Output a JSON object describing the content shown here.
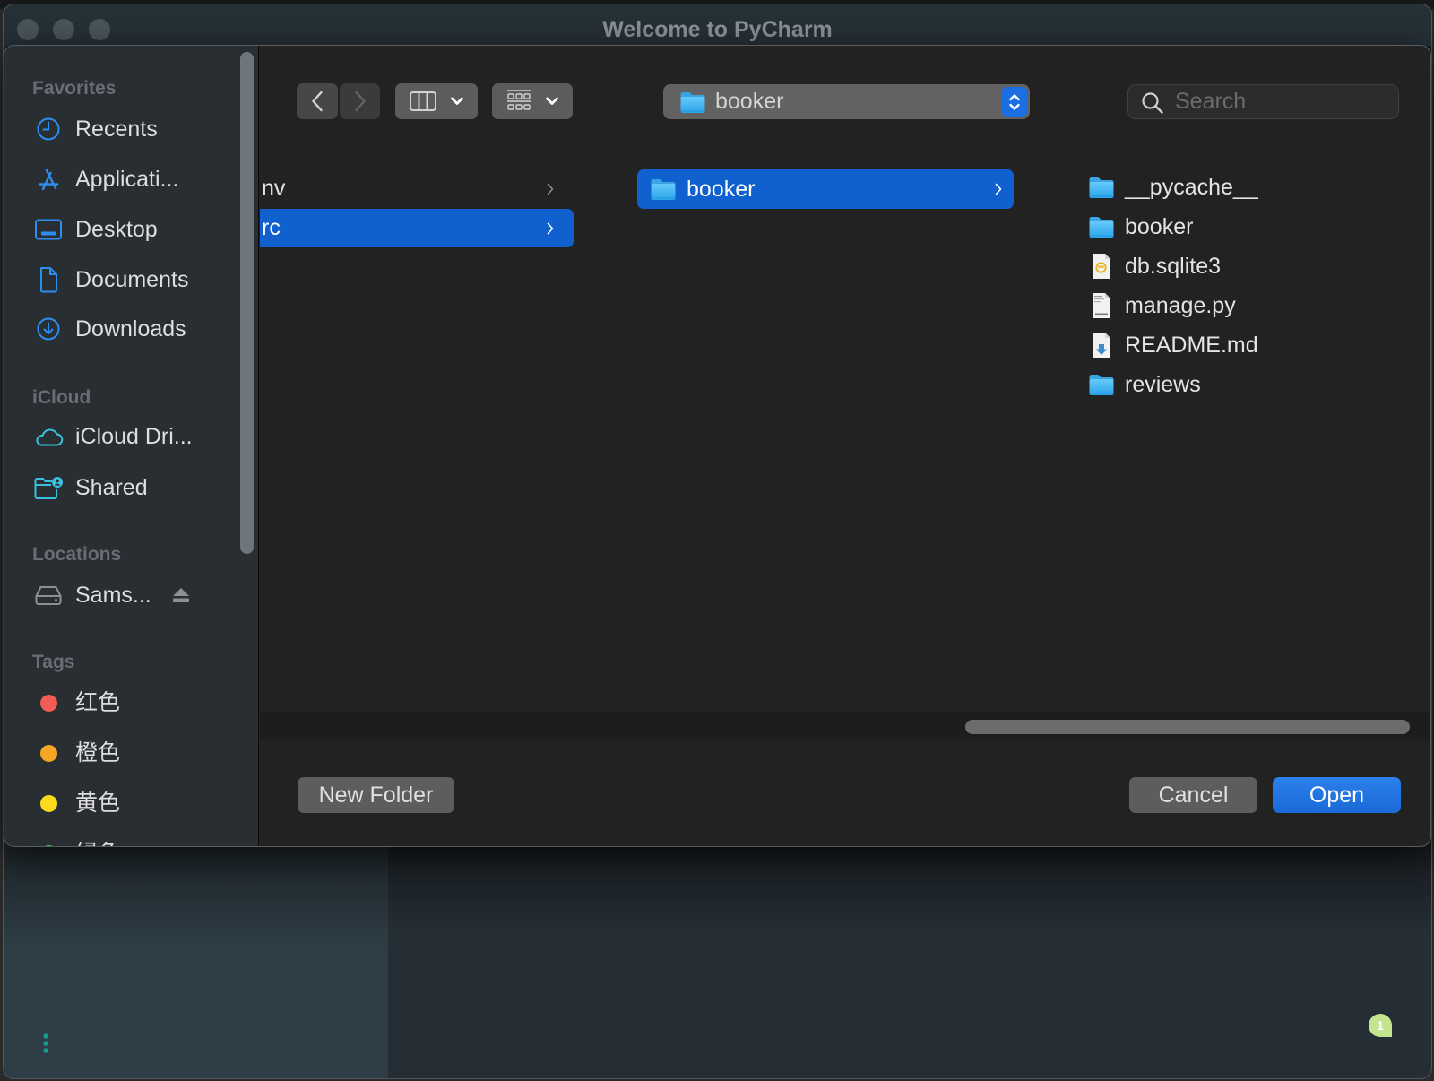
{
  "window": {
    "title": "Welcome to PyCharm",
    "notification_count": "1"
  },
  "dialog": {
    "sidebar": {
      "sections": [
        {
          "label": "Favorites",
          "items": [
            {
              "label": "Recents",
              "icon": "clock-icon"
            },
            {
              "label": "Applicati...",
              "icon": "applications-icon"
            },
            {
              "label": "Desktop",
              "icon": "desktop-icon"
            },
            {
              "label": "Documents",
              "icon": "document-icon"
            },
            {
              "label": "Downloads",
              "icon": "download-icon"
            }
          ]
        },
        {
          "label": "iCloud",
          "items": [
            {
              "label": "iCloud Dri...",
              "icon": "cloud-icon"
            },
            {
              "label": "Shared",
              "icon": "shared-folder-icon"
            }
          ]
        },
        {
          "label": "Locations",
          "items": [
            {
              "label": "Sams...",
              "icon": "hard-drive-icon",
              "action_icon": "eject-icon"
            }
          ]
        },
        {
          "label": "Tags",
          "items": [
            {
              "label": "红色",
              "color": "#f25c54"
            },
            {
              "label": "橙色",
              "color": "#f5a623"
            },
            {
              "label": "黄色",
              "color": "#fbdc1c"
            },
            {
              "label": "绿色",
              "color": "#35c94b"
            }
          ]
        }
      ]
    },
    "toolbar": {
      "back_icon": "chevron-left-icon",
      "forward_icon": "chevron-right-icon",
      "forward_enabled": false,
      "view_mode_icon": "columns-view-icon",
      "group_icon": "gallery-group-icon"
    },
    "path_popup": {
      "value": "booker",
      "icon": "folder-icon"
    },
    "search": {
      "placeholder": "Search",
      "value": ""
    },
    "columns": [
      {
        "items": [
          {
            "label": "nv",
            "kind": "folder",
            "has_children": true,
            "selected": false
          },
          {
            "label": "rc",
            "kind": "folder",
            "has_children": true,
            "selected": true
          }
        ]
      },
      {
        "items": [
          {
            "label": "booker",
            "kind": "folder",
            "has_children": true,
            "selected": true
          }
        ]
      },
      {
        "items": [
          {
            "label": "__pycache__",
            "kind": "folder"
          },
          {
            "label": "booker",
            "kind": "folder"
          },
          {
            "label": "db.sqlite3",
            "kind": "sqlite-file"
          },
          {
            "label": "manage.py",
            "kind": "python-file"
          },
          {
            "label": "README.md",
            "kind": "markdown-file"
          },
          {
            "label": "reviews",
            "kind": "folder"
          }
        ]
      }
    ],
    "buttons": {
      "new_folder": "New Folder",
      "cancel": "Cancel",
      "open": "Open"
    }
  },
  "colors": {
    "accent": "#1a6fe0",
    "selection": "#1060d0",
    "sidebar_icon": "#2e8ef0",
    "icloud_icon": "#39c1df",
    "notification_badge": "#c4e58f",
    "tool_window_dots": "#109e8e"
  }
}
